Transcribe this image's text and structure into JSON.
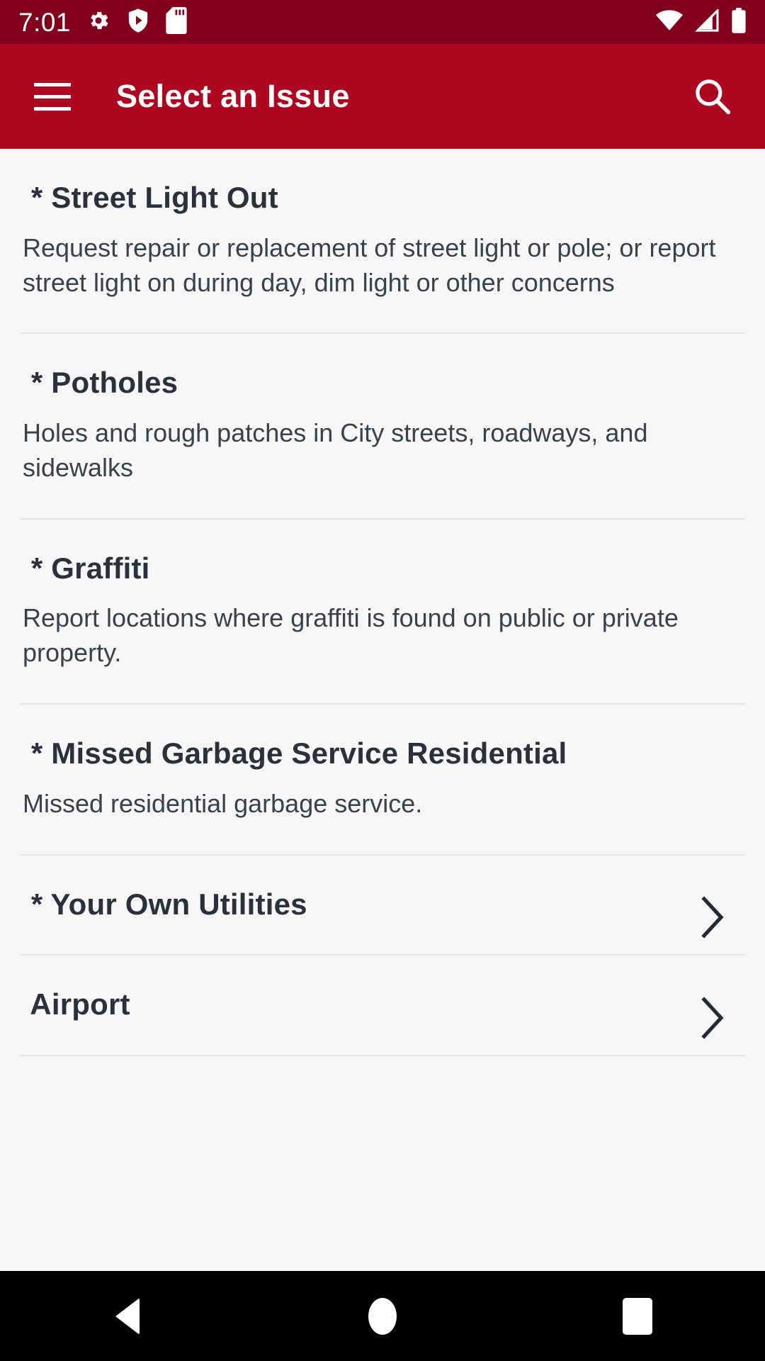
{
  "status_bar": {
    "clock": "7:01",
    "left_icons": [
      "gear-icon",
      "shield-play-icon",
      "sd-card-icon"
    ],
    "right_icons": [
      "wifi-icon",
      "cell-signal-icon",
      "battery-icon"
    ],
    "background_color": "#82001d"
  },
  "app_bar": {
    "title": "Select an Issue",
    "menu_icon": "hamburger-menu-icon",
    "search_icon": "search-icon",
    "background_color": "#ae0721",
    "text_color": "#ffffff"
  },
  "list": {
    "background_color": "#f7f7f8",
    "divider_color": "#e3e4e7",
    "title_color": "#2b313c",
    "description_color": "#3a4149",
    "items": [
      {
        "title": " * Street Light Out",
        "description": "Request repair or replacement of street light or pole; or report street light on during day, dim light or other concerns",
        "chevron": false
      },
      {
        "title": " * Potholes",
        "description": "Holes and rough patches in City streets, roadways, and sidewalks",
        "chevron": false
      },
      {
        "title": " * Graffiti",
        "description": "Report locations where graffiti is found on public or private property.",
        "chevron": false
      },
      {
        "title": " * Missed Garbage Service Residential",
        "description": "Missed residential garbage service.",
        "chevron": false
      },
      {
        "title": " * Your Own Utilities",
        "description": "",
        "chevron": true
      },
      {
        "title": " Airport",
        "description": "",
        "chevron": true
      }
    ]
  },
  "nav_bar": {
    "background_color": "#000000",
    "buttons": [
      {
        "name": "back",
        "icon": "back-triangle-icon"
      },
      {
        "name": "home",
        "icon": "home-circle-icon"
      },
      {
        "name": "recents",
        "icon": "recents-square-icon"
      }
    ]
  }
}
